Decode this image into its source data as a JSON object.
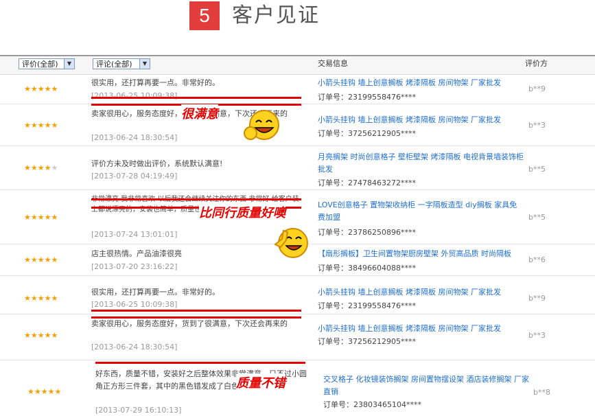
{
  "header": {
    "number": "5",
    "title": "客户见证"
  },
  "table": {
    "col_rating_select": "评价(全部)",
    "col_comment_select": "评论(全部)",
    "col_trade": "交易信息",
    "col_rater": "评价方"
  },
  "rows": [
    {
      "stars": 5,
      "comment": "很实用，还打算再要一点。非常好的。",
      "date": "[2013-06-25 10:09:38]",
      "product": "小箭头挂钩 墙上创意搁板 烤漆隔板 房间物架 厂家批发",
      "order": "订单号：23199558476****",
      "rater": "b**9"
    },
    {
      "stars": 5,
      "comment": "卖家很用心，服务态度好，货到了很满意，下次还会再来的",
      "date": "[2013-06-24 18:30:54]",
      "product": "小箭头挂钩 墙上创意搁板 烤漆隔板 房间物架 厂家批发",
      "order": "订单号：37256212905****",
      "rater": "b**3"
    },
    {
      "stars": 4,
      "comment": "评价方未及时做出评价，系统默认满意!",
      "date": "[2013-07-28 04:19:49]",
      "product": "月亮搁架 时尚创意格子 壁柜壁架 烤漆隔板 电视背景墙装饰柜批发",
      "order": "订单号：27478463272****",
      "rater": "b**5"
    },
    {
      "stars": 5,
      "comment": "非常漂亮 我非常喜欢 以后我还会继续关注你的东西 非常好 给客户装上都说漂亮的，安装也简单，质量也比同行的好 那里拿的好很多",
      "date": "[2013-07-24 13:01:01]",
      "product": "LOVE创意格子 置物架收纳柜 一字隔板造型 diy搁板 家具免费加盟",
      "order": "订单号：23786250896****",
      "rater": "b**5"
    },
    {
      "stars": 5,
      "comment": "店主很热情。产品油漆很亮",
      "date": "[2013-07-20 23:16:22]",
      "product": "【扇形搁板】卫生间置物架厨房壁架 外贸高品质 时尚隔板",
      "order": "订单号：38496604088****",
      "rater": "b**6"
    },
    {
      "stars": 5,
      "comment": "很实用，还打算再要一点。非常好的。",
      "date": "[2013-06-25 10:09:38]",
      "product": "小箭头挂钩 墙上创意搁板 烤漆隔板 房间物架 厂家批发",
      "order": "订单号：23199558476****",
      "rater": "b**9"
    },
    {
      "stars": 5,
      "comment": "卖家很用心，服务态度好，货到了很满意，下次还会再来的",
      "date": "[2013-06-24 18:30:54]",
      "product": "小箭头挂钩 墙上创意搁板 烤漆隔板 房间物架 厂家批发",
      "order": "订单号：37256212905****",
      "rater": "b**3"
    },
    {
      "stars": 5,
      "comment": "好东西，质量不错，安装好之后整体效果非常满意，只不过小圆角正方形三件套，其中的黑色错发成了白色。",
      "date": "[2013-07-29 16:10:13]",
      "product": "交叉格子 化妆镜装饰搁架 房间置物摆设架 酒店装修搁架 厂家直销",
      "order": "订单号：23803465104****",
      "rater": "b**8"
    }
  ],
  "stamps": [
    "很满意",
    "比同行质量好噢",
    "质量不错"
  ],
  "colors": {
    "accent": "#e23c3c",
    "link": "#1f6fd1",
    "star": "#f5a000",
    "stamp": "#e60000"
  }
}
